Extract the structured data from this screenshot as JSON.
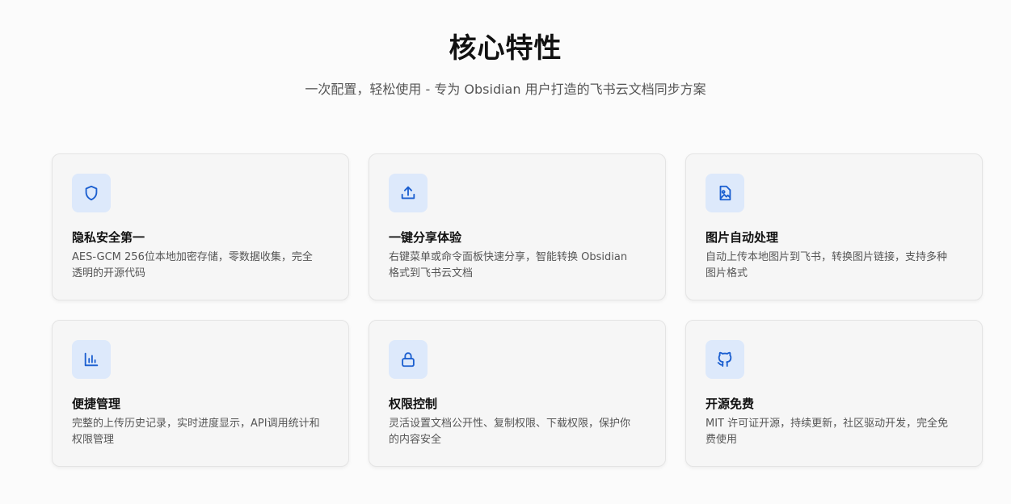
{
  "header": {
    "title": "核心特性",
    "subtitle": "一次配置，轻松使用 - 专为 Obsidian 用户打造的飞书云文档同步方案"
  },
  "accent_color": "#1b5fd0",
  "icon_bg_color": "#dde9fb",
  "features": [
    {
      "icon": "shield-icon",
      "title": "隐私安全第一",
      "description": "AES-GCM 256位本地加密存储，零数据收集，完全透明的开源代码"
    },
    {
      "icon": "upload-icon",
      "title": "一键分享体验",
      "description": "右键菜单或命令面板快速分享，智能转换 Obsidian 格式到飞书云文档"
    },
    {
      "icon": "image-file-icon",
      "title": "图片自动处理",
      "description": "自动上传本地图片到飞书，转换图片链接，支持多种图片格式"
    },
    {
      "icon": "bar-chart-icon",
      "title": "便捷管理",
      "description": "完整的上传历史记录，实时进度显示，API调用统计和权限管理"
    },
    {
      "icon": "lock-icon",
      "title": "权限控制",
      "description": "灵活设置文档公开性、复制权限、下载权限，保护你的内容安全"
    },
    {
      "icon": "github-icon",
      "title": "开源免费",
      "description": "MIT 许可证开源，持续更新，社区驱动开发，完全免费使用"
    }
  ]
}
